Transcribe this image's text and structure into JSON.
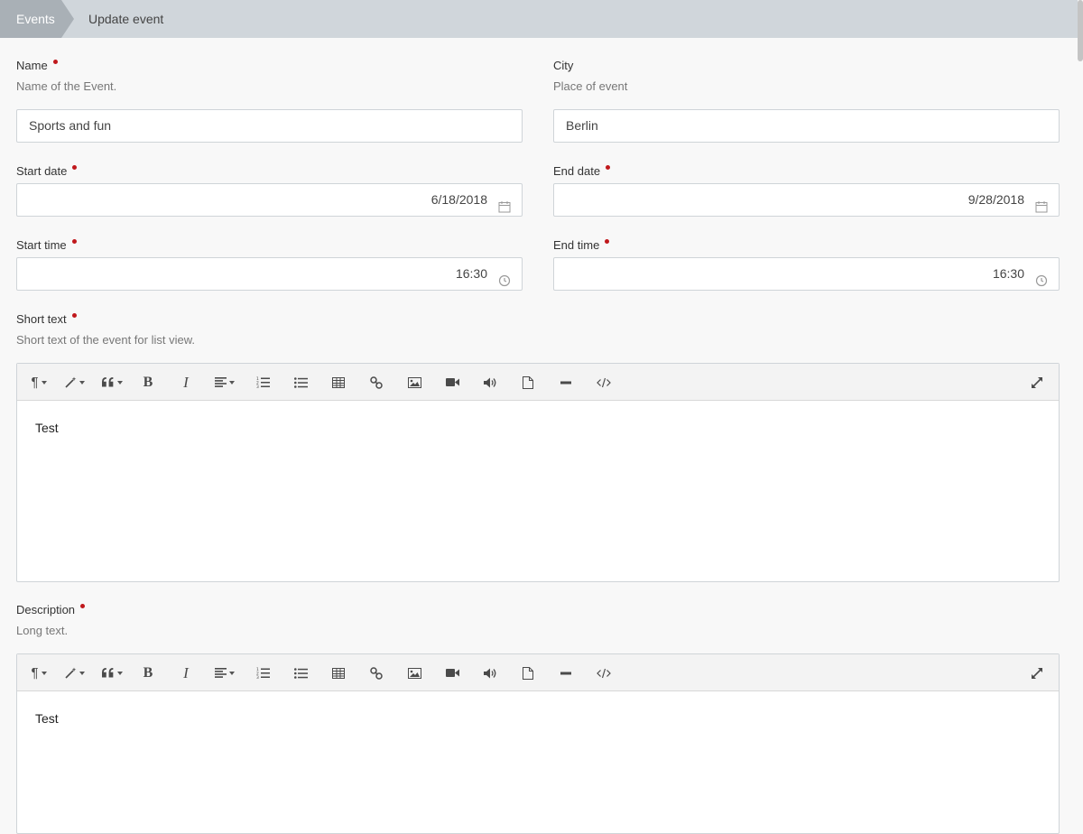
{
  "breadcrumb": {
    "root": "Events",
    "current": "Update event"
  },
  "fields": {
    "name": {
      "label": "Name",
      "help": "Name of the Event.",
      "value": "Sports and fun"
    },
    "city": {
      "label": "City",
      "help": "Place of event",
      "value": "Berlin"
    },
    "start_date": {
      "label": "Start date",
      "value": "6/18/2018"
    },
    "end_date": {
      "label": "End date",
      "value": "9/28/2018"
    },
    "start_time": {
      "label": "Start time",
      "value": "16:30"
    },
    "end_time": {
      "label": "End time",
      "value": "16:30"
    },
    "short_text": {
      "label": "Short text",
      "help": "Short text of the event for list view.",
      "content": "Test"
    },
    "description": {
      "label": "Description",
      "help": "Long text.",
      "content": "Test"
    }
  },
  "toolbar": {
    "bold": "B",
    "italic": "I",
    "paragraph": "¶",
    "icons": [
      "paragraph-icon",
      "magic-wand-icon",
      "quote-icon",
      "bold-icon",
      "italic-icon",
      "align-icon",
      "ordered-list-icon",
      "unordered-list-icon",
      "table-icon",
      "link-icon",
      "image-icon",
      "video-icon",
      "audio-icon",
      "file-icon",
      "horizontal-rule-icon",
      "code-icon",
      "fullscreen-icon"
    ]
  },
  "colors": {
    "required": "#c0181c",
    "topbar": "#d0d6db",
    "crumb_active": "#a9b0b6"
  }
}
